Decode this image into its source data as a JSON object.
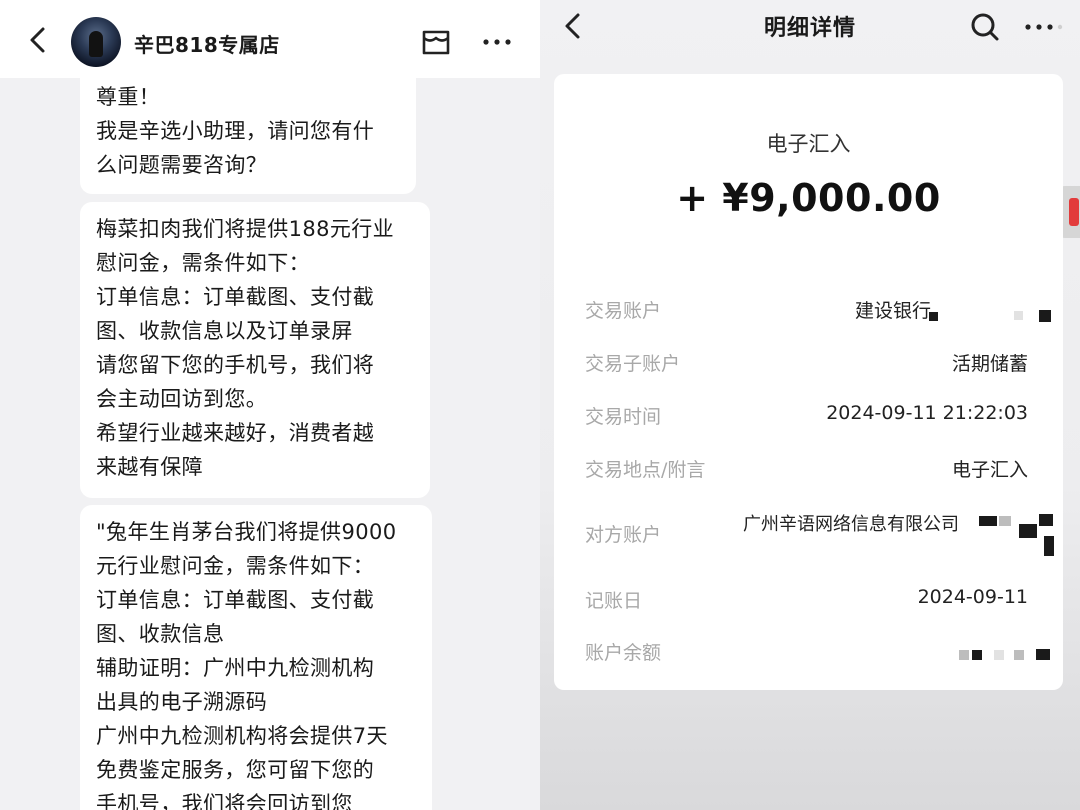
{
  "chat": {
    "shop_name": "辛巴818专属店",
    "messages": [
      {
        "lines": [
          "尊重！",
          "我是辛选小助理，请问您有什",
          "么问题需要咨询？"
        ]
      },
      {
        "lines": [
          "梅菜扣肉我们将提供188元行业",
          "慰问金，需条件如下：",
          "订单信息：订单截图、支付截",
          "图、收款信息以及订单录屏",
          "请您留下您的手机号，我们将",
          "会主动回访到您。",
          "希望行业越来越好，消费者越",
          "来越有保障"
        ]
      },
      {
        "lines": [
          "\"兔年生肖茅台我们将提供9000",
          "元行业慰问金，需条件如下：",
          "订单信息：订单截图、支付截",
          "图、收款信息",
          "辅助证明：广州中九检测机构",
          "出具的电子溯源码",
          "广州中九检测机构将会提供7天",
          "免费鉴定服务，您可留下您的",
          "手机号，我们将会回访到您"
        ]
      }
    ]
  },
  "detail": {
    "title": "明细详情",
    "tx_type": "电子汇入",
    "amount": "+ ¥9,000.00",
    "rows": [
      {
        "label": "交易账户",
        "value": "建设银行"
      },
      {
        "label": "交易子账户",
        "value": "活期储蓄"
      },
      {
        "label": "交易时间",
        "value": "2024-09-11 21:22:03"
      },
      {
        "label": "交易地点/附言",
        "value": "电子汇入"
      },
      {
        "label": "对方账户",
        "value": "广州辛语网络信息有限公司"
      },
      {
        "label": "记账日",
        "value": "2024-09-11"
      },
      {
        "label": "账户余额",
        "value": ""
      }
    ]
  },
  "colors": {
    "bubble": "#ffffff",
    "chat_bg": "#f1f1f3",
    "label_gray": "#a8a8a8"
  }
}
